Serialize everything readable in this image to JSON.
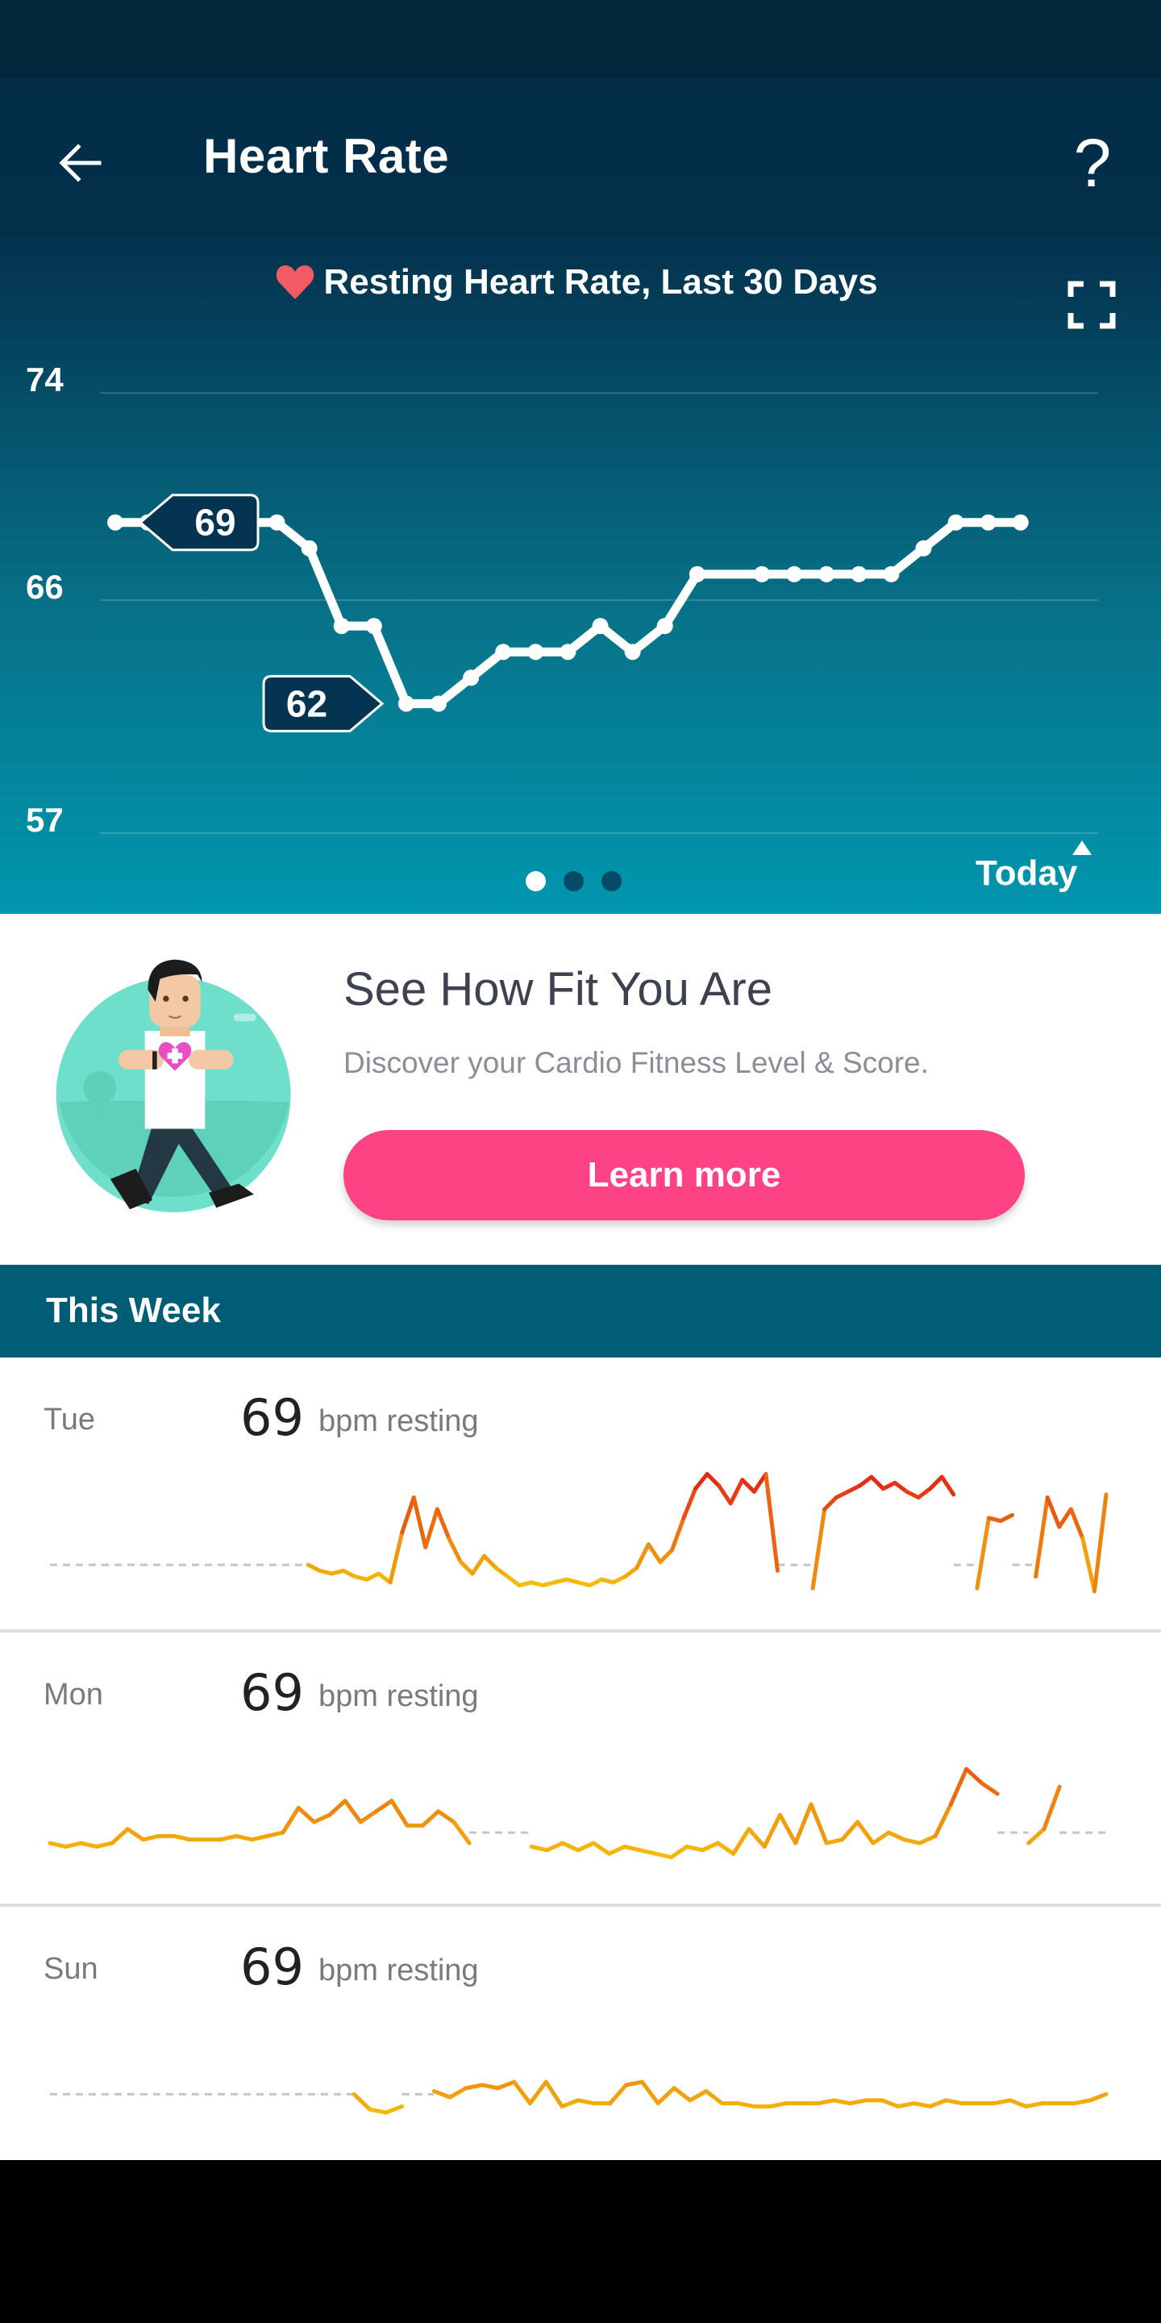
{
  "app_bar": {
    "title": "Heart Rate",
    "back_icon": "arrow-left-icon",
    "help_label": "?",
    "help_icon": "question-mark-icon"
  },
  "chart_header": {
    "subtitle": "Resting Heart Rate, Last 30 Days",
    "heart_icon": "heart-icon",
    "expand_icon": "fullscreen-icon"
  },
  "colors": {
    "accent_pink": "#fe4384",
    "heart_red": "#f25a64",
    "header_teal": "#015d76",
    "label_navy": "#04344f"
  },
  "chart_data": {
    "type": "line",
    "title": "Resting Heart Rate, Last 30 Days",
    "xlabel": "",
    "ylabel": "",
    "y_ticks": [
      74,
      66,
      57
    ],
    "ylim": [
      57,
      74
    ],
    "grid": true,
    "x_end_label": "Today",
    "values": [
      69,
      69,
      69,
      69,
      69,
      69,
      68,
      65,
      65,
      62,
      62,
      63,
      64,
      64,
      64,
      65,
      64,
      65,
      67,
      null,
      67,
      67,
      67,
      67,
      67,
      68,
      69,
      69,
      69
    ],
    "annotations": [
      {
        "label": "69",
        "kind": "max",
        "index": 0
      },
      {
        "label": "62",
        "kind": "min",
        "index": 9
      }
    ]
  },
  "pager": {
    "count": 3,
    "active": 0
  },
  "promo": {
    "title": "See How Fit You Are",
    "description": "Discover your Cardio Fitness Level & Score.",
    "button_label": "Learn more",
    "illustration": "walking-man-illustration"
  },
  "week": {
    "header": "This Week",
    "days": [
      {
        "day": "Tue",
        "value": "69",
        "unit": "bpm resting",
        "resting": 69,
        "series": [
          null,
          null,
          null,
          null,
          null,
          null,
          null,
          null,
          null,
          null,
          null,
          null,
          null,
          null,
          null,
          null,
          null,
          null,
          null,
          null,
          null,
          null,
          69,
          67,
          66,
          67,
          65,
          64,
          66,
          63,
          80,
          92,
          75,
          88,
          78,
          70,
          66,
          72,
          68,
          65,
          62,
          63,
          62,
          63,
          64,
          63,
          62,
          64,
          63,
          65,
          68,
          76,
          70,
          74,
          85,
          95,
          100,
          96,
          90,
          98,
          94,
          100,
          67,
          null,
          null,
          61,
          88,
          92,
          94,
          96,
          99,
          95,
          97,
          94,
          92,
          95,
          99,
          93,
          null,
          61,
          85,
          84,
          86,
          null,
          65,
          92,
          82,
          88,
          78,
          60,
          93
        ],
        "ymin": 58,
        "ymax": 104
      },
      {
        "day": "Mon",
        "value": "69",
        "unit": "bpm resting",
        "resting": 69,
        "series": [
          66,
          65,
          66,
          65,
          66,
          70,
          67,
          68,
          68,
          67,
          67,
          67,
          68,
          67,
          68,
          69,
          76,
          72,
          74,
          78,
          72,
          75,
          78,
          71,
          71,
          75,
          72,
          66,
          null,
          null,
          null,
          65,
          64,
          66,
          64,
          66,
          63,
          65,
          64,
          63,
          62,
          65,
          64,
          66,
          63,
          70,
          65,
          74,
          66,
          77,
          66,
          67,
          72,
          66,
          69,
          67,
          66,
          68,
          77,
          87,
          83,
          80,
          null,
          66,
          70,
          82,
          null,
          null,
          null
        ],
        "ymin": 58,
        "ymax": 96
      },
      {
        "day": "Sun",
        "value": "69",
        "unit": "bpm resting",
        "resting": 69,
        "series": [
          null,
          null,
          null,
          null,
          null,
          null,
          null,
          null,
          null,
          null,
          null,
          null,
          null,
          null,
          null,
          null,
          null,
          null,
          null,
          69,
          64,
          63,
          65,
          null,
          70,
          68,
          71,
          72,
          71,
          73,
          66,
          73,
          65,
          67,
          66,
          66,
          72,
          73,
          66,
          71,
          67,
          70,
          66,
          66,
          65,
          65,
          66,
          66,
          66,
          67,
          66,
          67,
          67,
          65,
          66,
          65,
          67,
          66,
          66,
          66,
          67,
          65,
          66,
          66,
          66,
          67,
          69
        ],
        "ymin": 58,
        "ymax": 96
      }
    ]
  }
}
